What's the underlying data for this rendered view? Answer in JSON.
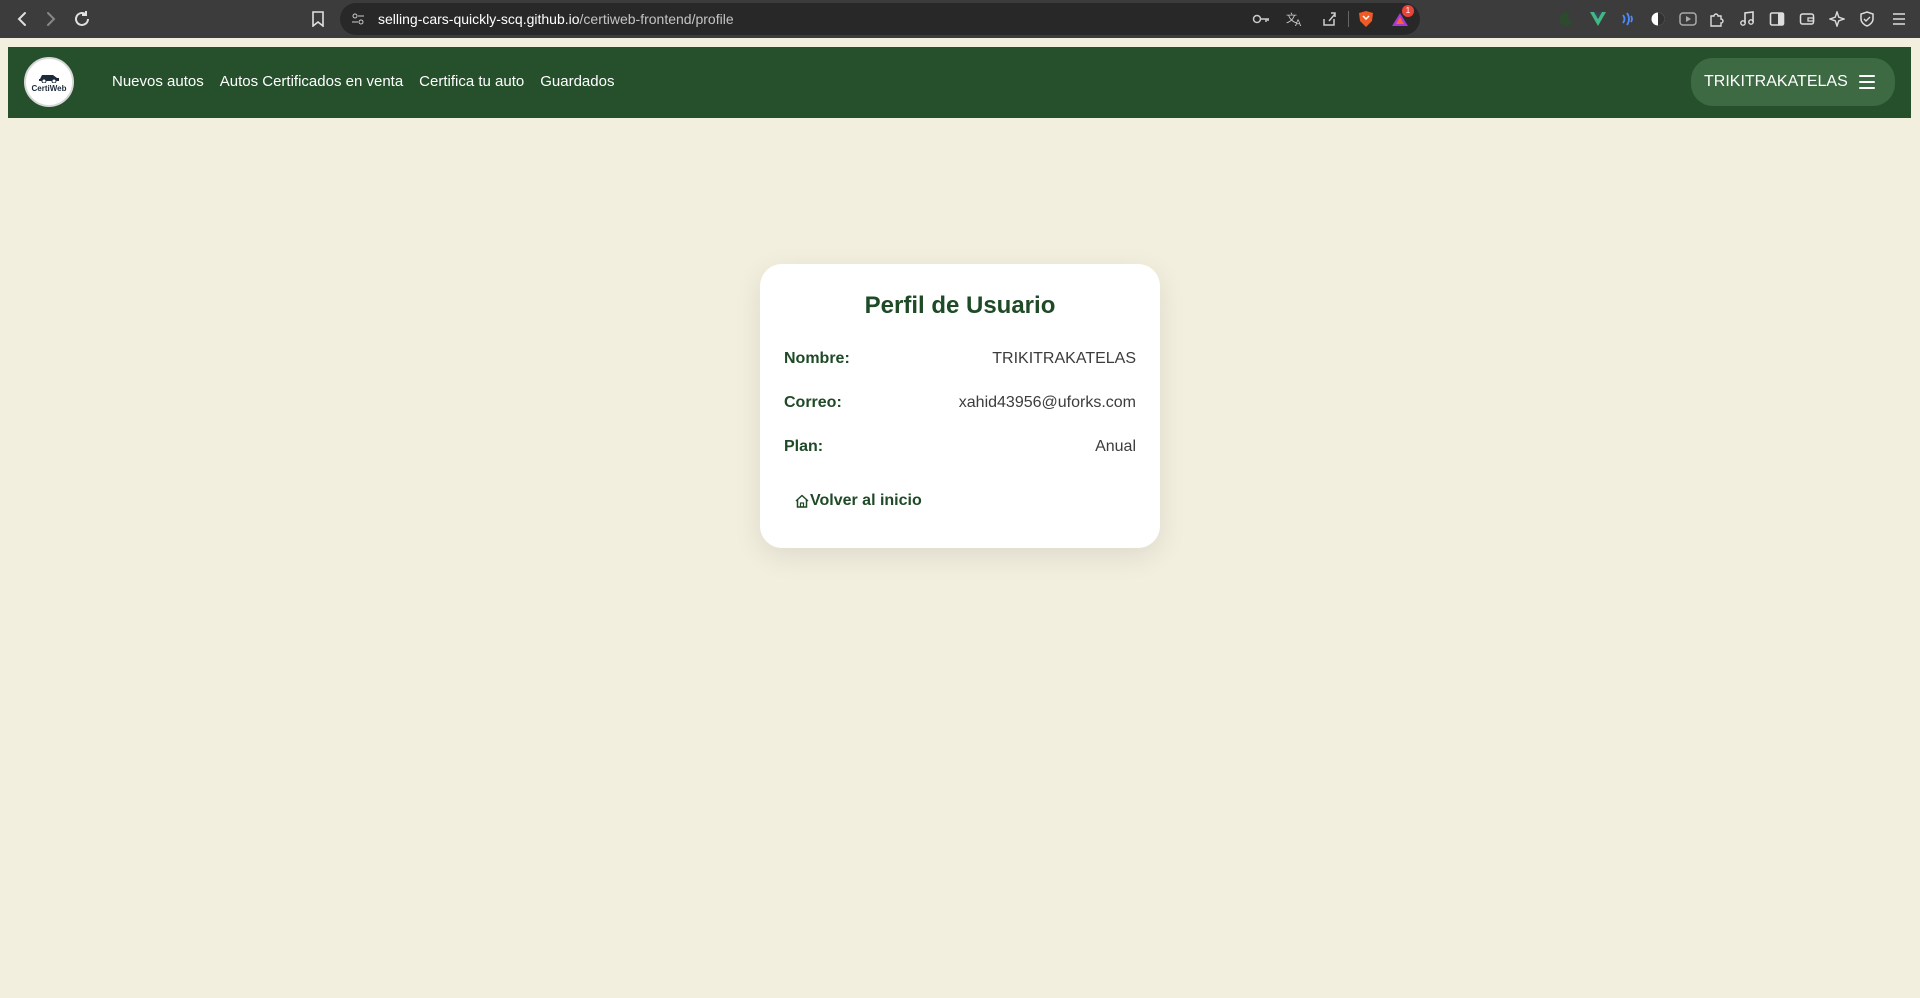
{
  "browser": {
    "url_host": "selling-cars-quickly-scq.github.io",
    "url_path": "/certiweb-frontend/profile",
    "notification_count": "1"
  },
  "navbar": {
    "logo_text": "CertiWeb",
    "links": [
      {
        "label": "Nuevos autos"
      },
      {
        "label": "Autos Certificados en venta"
      },
      {
        "label": "Certifica tu auto"
      },
      {
        "label": "Guardados"
      }
    ],
    "user_name": "TRIKITRAKATELAS"
  },
  "profile": {
    "title": "Perfil de Usuario",
    "fields": [
      {
        "label": "Nombre:",
        "value": "TRIKITRAKATELAS"
      },
      {
        "label": "Correo:",
        "value": "xahid43956@uforks.com"
      },
      {
        "label": "Plan:",
        "value": "Anual"
      }
    ],
    "back_label": "Volver al inicio"
  },
  "colors": {
    "navbar_bg": "#26502c",
    "page_bg": "#f3efdf",
    "accent_text": "#1f4a27",
    "user_pill_bg": "#3d6a42"
  }
}
